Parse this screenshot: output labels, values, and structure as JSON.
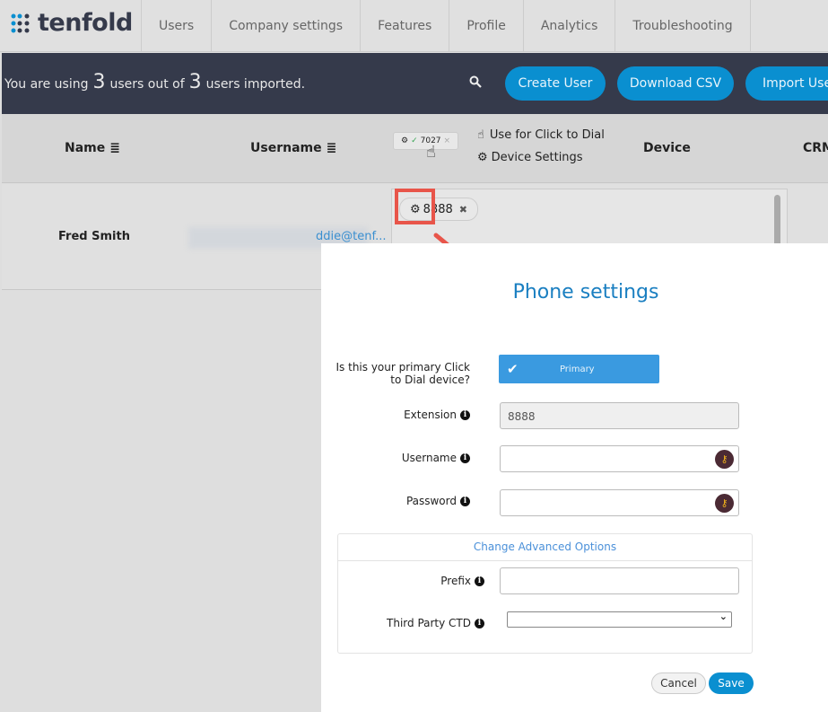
{
  "nav": {
    "brand": "tenfold",
    "tabs": [
      "Users",
      "Company settings",
      "Features",
      "Profile",
      "Analytics",
      "Troubleshooting"
    ]
  },
  "bar": {
    "prefix": "You are using",
    "used": "3",
    "middle": "users out of",
    "total": "3",
    "suffix": "users imported.",
    "buttons": [
      "Create User",
      "Download CSV",
      "Import Users"
    ],
    "search_icon": "search-icon"
  },
  "table": {
    "headers": {
      "name": "Name",
      "username": "Username",
      "device": "Device",
      "crm": "CRM"
    },
    "legend": {
      "chip": "7027",
      "click_to_dial": "Use for Click to Dial",
      "device_settings": "Device Settings"
    },
    "row": {
      "name": "Fred Smith",
      "username": "ddie@tenf...",
      "device_chip": "8888"
    }
  },
  "modal": {
    "title": "Phone settings",
    "primary_label": "Is this your primary Click to Dial device?",
    "primary_button": "Primary",
    "extension_label": "Extension",
    "extension_value": "8888",
    "username_label": "Username",
    "username_value": "",
    "password_label": "Password",
    "password_value": "",
    "advanced_title": "Change Advanced Options",
    "prefix_label": "Prefix",
    "prefix_value": "",
    "third_party_label": "Third Party CTD",
    "third_party_value": "",
    "cancel": "Cancel",
    "save": "Save"
  },
  "colors": {
    "accent": "#0a8fd0",
    "bar_bg": "#353a4b",
    "annotation": "#e8554a",
    "primary_btn": "#3a9ae0"
  }
}
